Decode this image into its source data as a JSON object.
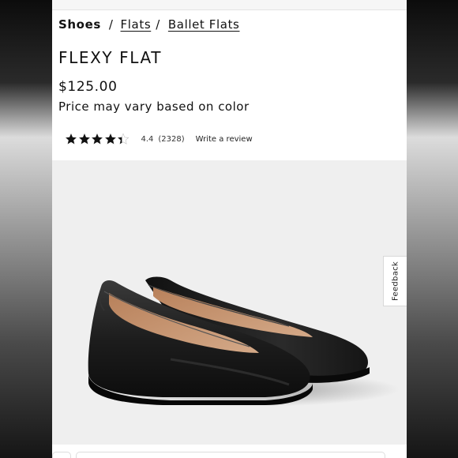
{
  "breadcrumb": {
    "items": [
      {
        "label": "Shoes"
      },
      {
        "label": "Flats"
      },
      {
        "label": "Ballet Flats"
      }
    ],
    "separator": "/"
  },
  "product": {
    "title": "FLEXY FLAT",
    "price": "$125.00",
    "price_note": "Price may vary based on color"
  },
  "rating": {
    "value": "4.4",
    "count": "(2328)",
    "stars_fraction": 0.88,
    "write_review_label": "Write a review"
  },
  "feedback": {
    "label": "Feedback"
  },
  "image": {
    "icon": "black-ballet-flats-photo",
    "background_color": "#efefef"
  },
  "colors": {
    "text": "#111111",
    "star": "#111111"
  }
}
